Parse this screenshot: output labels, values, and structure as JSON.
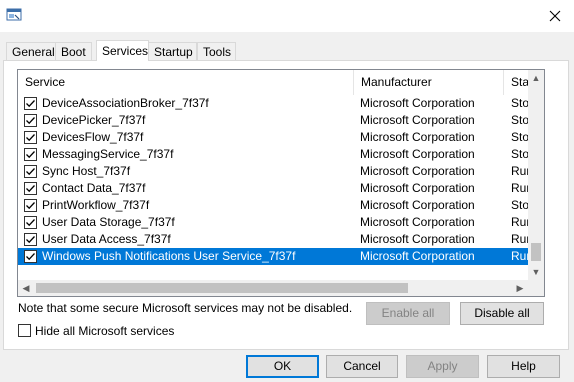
{
  "window": {
    "title": ""
  },
  "tabs": [
    {
      "label": "General",
      "active": false
    },
    {
      "label": "Boot",
      "active": false
    },
    {
      "label": "Services",
      "active": true
    },
    {
      "label": "Startup",
      "active": false
    },
    {
      "label": "Tools",
      "active": false
    }
  ],
  "list": {
    "columns": [
      "Service",
      "Manufacturer",
      "Sta"
    ],
    "rows": [
      {
        "service": "DeviceAssociationBroker_7f37f",
        "manufacturer": "Microsoft Corporation",
        "status": "Sto",
        "checked": true
      },
      {
        "service": "DevicePicker_7f37f",
        "manufacturer": "Microsoft Corporation",
        "status": "Sto",
        "checked": true
      },
      {
        "service": "DevicesFlow_7f37f",
        "manufacturer": "Microsoft Corporation",
        "status": "Sto",
        "checked": true
      },
      {
        "service": "MessagingService_7f37f",
        "manufacturer": "Microsoft Corporation",
        "status": "Sto",
        "checked": true
      },
      {
        "service": "Sync Host_7f37f",
        "manufacturer": "Microsoft Corporation",
        "status": "Run",
        "checked": true
      },
      {
        "service": "Contact Data_7f37f",
        "manufacturer": "Microsoft Corporation",
        "status": "Run",
        "checked": true
      },
      {
        "service": "PrintWorkflow_7f37f",
        "manufacturer": "Microsoft Corporation",
        "status": "Sto",
        "checked": true
      },
      {
        "service": "User Data Storage_7f37f",
        "manufacturer": "Microsoft Corporation",
        "status": "Run",
        "checked": true
      },
      {
        "service": "User Data Access_7f37f",
        "manufacturer": "Microsoft Corporation",
        "status": "Run",
        "checked": true
      },
      {
        "service": "Windows Push Notifications User Service_7f37f",
        "manufacturer": "Microsoft Corporation",
        "status": "Run",
        "checked": true,
        "selected": true
      }
    ]
  },
  "note": "Note that some secure Microsoft services may not be disabled.",
  "buttons": {
    "enable_all": "Enable all",
    "disable_all": "Disable all",
    "ok": "OK",
    "cancel": "Cancel",
    "apply": "Apply",
    "help": "Help"
  },
  "hide_ms": {
    "label": "Hide all Microsoft services",
    "checked": false
  },
  "colors": {
    "selection": "#0078d7",
    "panel": "#ffffff",
    "dialog_bg": "#f0f0f0"
  }
}
